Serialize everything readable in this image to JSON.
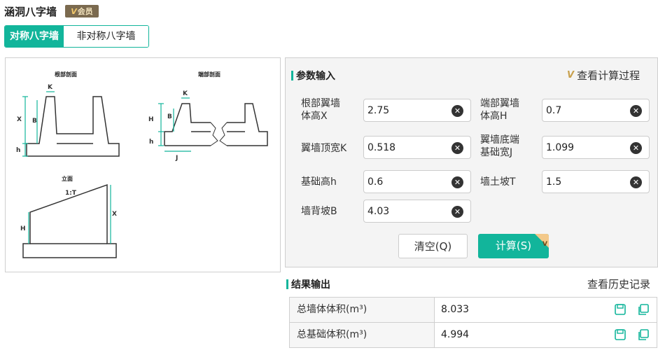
{
  "header": {
    "title": "涵洞八字墙",
    "vip_badge": "会员",
    "vip_badge_prefix": "V"
  },
  "tabs": [
    {
      "label": "对称八字墙",
      "active": true
    },
    {
      "label": "非对称八字墙",
      "active": false
    }
  ],
  "diagram": {
    "root_section_title": "根部剖面",
    "end_section_title": "端部剖面",
    "elevation_title": "立面",
    "labels": {
      "K": "K",
      "X": "X",
      "B": "B",
      "h": "h",
      "H": "H",
      "J": "J",
      "slope": "1:T"
    }
  },
  "params": {
    "section_title": "参数输入",
    "view_calc_link": "查看计算过程",
    "fields": [
      {
        "label_line1": "根部翼墙",
        "label_line2": "体高X",
        "value": "2.75"
      },
      {
        "label_line1": "端部翼墙",
        "label_line2": "体高H",
        "value": "0.7"
      },
      {
        "label_line1": "翼墙顶宽K",
        "label_line2": "",
        "value": "0.518"
      },
      {
        "label_line1": "翼墙底端",
        "label_line2": "基础宽J",
        "value": "1.099"
      },
      {
        "label_line1": "基础高h",
        "label_line2": "",
        "value": "0.6"
      },
      {
        "label_line1": "墙土坡T",
        "label_line2": "",
        "value": "1.5"
      },
      {
        "label_line1": "墙背坡B",
        "label_line2": "",
        "value": "4.03"
      }
    ],
    "clear_button": "清空(Q)",
    "calc_button": "计算(S)"
  },
  "results": {
    "section_title": "结果输出",
    "history_link": "查看历史记录",
    "rows": [
      {
        "label": "总墙体体积(m³)",
        "value": "8.033"
      },
      {
        "label": "总基础体积(m³)",
        "value": "4.994"
      }
    ]
  },
  "colors": {
    "accent": "#12b59b",
    "vip_gold": "#c8a04d"
  }
}
